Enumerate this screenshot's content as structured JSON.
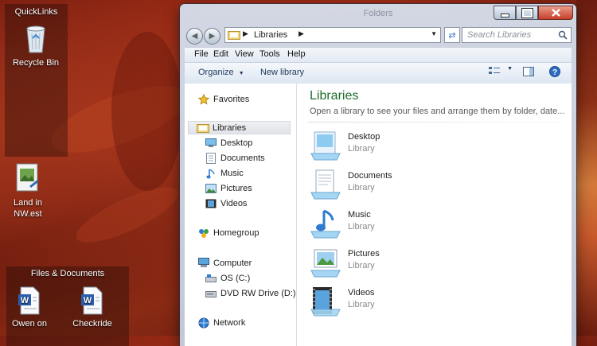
{
  "desktop": {
    "quicklinks": {
      "title": "QuickLinks",
      "recycle_bin": "Recycle Bin"
    },
    "land_file": {
      "label_line1": "Land in",
      "label_line2": "NW.est"
    },
    "files_docs": {
      "title": "Files & Documents",
      "doc1": "Owen on",
      "doc2": "Checkride"
    }
  },
  "window": {
    "title": "Folders",
    "address": {
      "crumb": "Libraries"
    },
    "search_placeholder": "Search Libraries",
    "menu": [
      "File",
      "Edit",
      "View",
      "Tools",
      "Help"
    ],
    "toolbar": {
      "organize": "Organize",
      "new_library": "New library"
    },
    "nav": {
      "favorites": "Favorites",
      "libraries": "Libraries",
      "desktop": "Desktop",
      "documents": "Documents",
      "music": "Music",
      "pictures": "Pictures",
      "videos": "Videos",
      "homegroup": "Homegroup",
      "computer": "Computer",
      "os_c": "OS (C:)",
      "dvd": "DVD RW Drive (D:) Cl",
      "network": "Network"
    },
    "content": {
      "title": "Libraries",
      "subtitle": "Open a library to see your files and arrange them by folder, date...",
      "items": [
        {
          "name": "Desktop",
          "type": "Library"
        },
        {
          "name": "Documents",
          "type": "Library"
        },
        {
          "name": "Music",
          "type": "Library"
        },
        {
          "name": "Pictures",
          "type": "Library"
        },
        {
          "name": "Videos",
          "type": "Library"
        }
      ]
    }
  },
  "colors": {
    "accent_title": "#1e6e2c",
    "link": "#1e395b",
    "close_button": "#c7402a"
  }
}
